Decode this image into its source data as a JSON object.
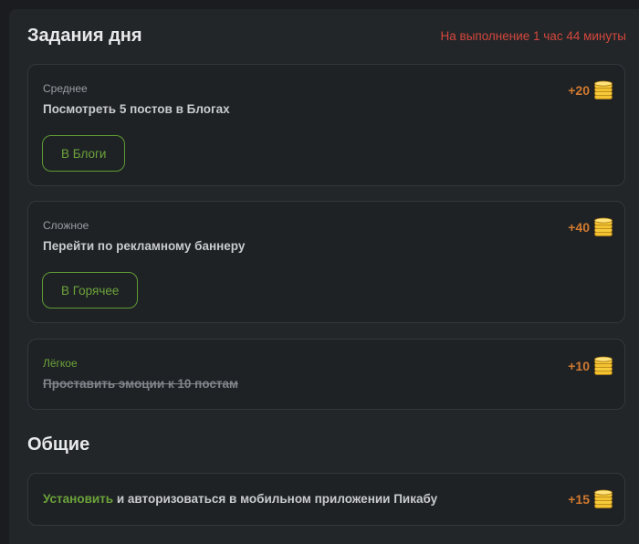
{
  "daily": {
    "title": "Задания дня",
    "timer": "На выполнение 1 час 44 минуты",
    "tasks": [
      {
        "difficulty": "Среднее",
        "text": "Посмотреть 5 постов в Блогах",
        "reward": "+20",
        "button": "В Блоги"
      },
      {
        "difficulty": "Сложное",
        "text": "Перейти по рекламному баннеру",
        "reward": "+40",
        "button": "В Горячее"
      },
      {
        "difficulty": "Лёгкое",
        "text": "Проставить эмоции к 10 постам",
        "reward": "+10",
        "completed": true
      }
    ]
  },
  "general": {
    "title": "Общие",
    "tasks": [
      {
        "link": "Установить",
        "text": " и авторизоваться в мобильном приложении Пикабу",
        "reward": "+15"
      }
    ]
  },
  "colors": {
    "accent_green": "#6ba33a",
    "reward_orange": "#d1792f",
    "timer_red": "#d2473c",
    "coin": "#f2c230"
  },
  "icons": {
    "reward": "coin-stack-icon"
  }
}
